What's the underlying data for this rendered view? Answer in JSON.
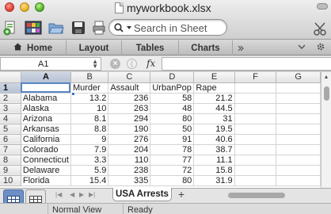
{
  "window": {
    "title": "myworkbook.xlsx"
  },
  "toolbar": {
    "search_placeholder": "Search in Sheet",
    "icons": [
      "new-document-icon",
      "gallery-icon",
      "open-folder-icon",
      "save-icon",
      "print-icon",
      "search-icon",
      "cut-icon"
    ]
  },
  "ribbon": {
    "tabs": [
      "Home",
      "Layout",
      "Tables",
      "Charts"
    ],
    "icons": [
      "home-icon",
      "more-tabs-icon",
      "collapse-ribbon-icon",
      "gear-icon"
    ]
  },
  "formula_bar": {
    "name_box": "A1",
    "fx_label": "fx",
    "formula_value": ""
  },
  "sheet": {
    "active_cell": "A1",
    "column_letters": [
      "A",
      "B",
      "C",
      "D",
      "E",
      "F",
      "G"
    ],
    "row_numbers": [
      "1",
      "2",
      "3",
      "4",
      "5",
      "6",
      "7",
      "8",
      "9",
      "10"
    ],
    "rows": [
      [
        "",
        "Murder",
        "Assault",
        "UrbanPop",
        "Rape",
        "",
        ""
      ],
      [
        "Alabama",
        "13.2",
        "236",
        "58",
        "21.2",
        "",
        ""
      ],
      [
        "Alaska",
        "10",
        "263",
        "48",
        "44.5",
        "",
        ""
      ],
      [
        "Arizona",
        "8.1",
        "294",
        "80",
        "31",
        "",
        ""
      ],
      [
        "Arkansas",
        "8.8",
        "190",
        "50",
        "19.5",
        "",
        ""
      ],
      [
        "California",
        "9",
        "276",
        "91",
        "40.6",
        "",
        ""
      ],
      [
        "Colorado",
        "7.9",
        "204",
        "78",
        "38.7",
        "",
        ""
      ],
      [
        "Connecticut",
        "3.3",
        "110",
        "77",
        "11.1",
        "",
        ""
      ],
      [
        "Delaware",
        "5.9",
        "238",
        "72",
        "15.8",
        "",
        ""
      ],
      [
        "Florida",
        "15.4",
        "335",
        "80",
        "31.9",
        "",
        ""
      ]
    ]
  },
  "tabs": {
    "sheet_name": "USA Arrests",
    "add_label": "+"
  },
  "status": {
    "view_mode": "Normal View",
    "state": "Ready"
  },
  "colors": {
    "selection": "#5a86c4",
    "view_button_active": "#6d8fc7"
  }
}
